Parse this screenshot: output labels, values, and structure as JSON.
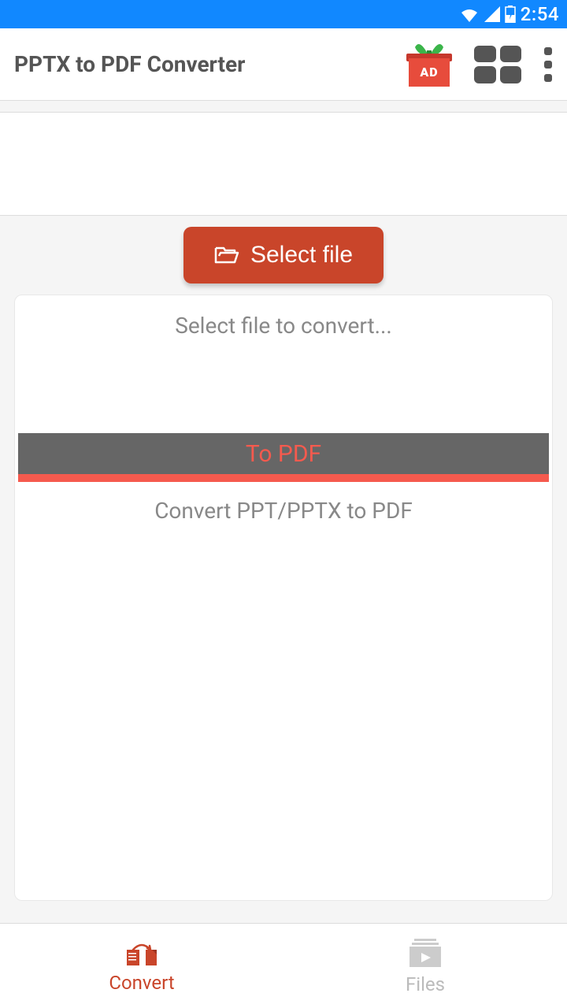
{
  "status": {
    "time": "2:54"
  },
  "header": {
    "title": "PPTX to PDF Converter",
    "ad_label": "AD"
  },
  "main": {
    "select_button": "Select file",
    "hint": "Select file to convert...",
    "action_bar": "To PDF",
    "description": "Convert PPT/PPTX to PDF"
  },
  "nav": {
    "convert": "Convert",
    "files": "Files"
  }
}
